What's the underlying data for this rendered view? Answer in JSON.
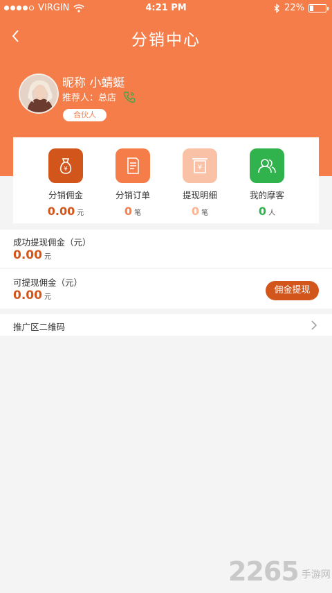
{
  "status_bar": {
    "carrier": "VIRGIN",
    "time": "4:21 PM",
    "battery": "22%"
  },
  "nav": {
    "title": "分销中心"
  },
  "profile": {
    "nickname": "昵称  小蜻蜓",
    "referrer": "推荐人：总店",
    "badge": "合伙人"
  },
  "stats": [
    {
      "label": "分销佣金",
      "value": "0.00",
      "unit": "元",
      "color": "#d2561c",
      "icon": "money-bag-icon"
    },
    {
      "label": "分销订单",
      "value": "0",
      "unit": "笔",
      "color": "#f47d49",
      "icon": "order-list-icon"
    },
    {
      "label": "提现明细",
      "value": "0",
      "unit": "笔",
      "color": "#f9b593",
      "icon": "withdraw-detail-icon"
    },
    {
      "label": "我的摩客",
      "value": "0",
      "unit": "人",
      "color": "#30b24c",
      "icon": "team-icon"
    }
  ],
  "success_withdraw": {
    "label": "成功提现佣金（元）",
    "value": "0.00",
    "unit": "元"
  },
  "available": {
    "label": "可提现佣金（元）",
    "value": "0.00",
    "unit": "元",
    "button": "佣金提现"
  },
  "qrcode": {
    "label": "推广区二维码"
  },
  "watermark": {
    "number": "2265",
    "site": "手游网"
  },
  "colors": {
    "header": "#f47d49",
    "accent": "#d2561c",
    "green": "#30b24c"
  }
}
